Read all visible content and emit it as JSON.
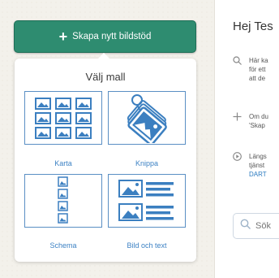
{
  "create_button": {
    "label": "Skapa nytt bildstöd",
    "icon": "plus-icon"
  },
  "templates_panel": {
    "title": "Välj mall",
    "templates": [
      {
        "label": "Karta",
        "icon": "grid-images-icon"
      },
      {
        "label": "Knippa",
        "icon": "tagged-bundle-icon"
      },
      {
        "label": "Schema",
        "icon": "vertical-schedule-icon"
      },
      {
        "label": "Bild och text",
        "icon": "image-with-text-icon"
      }
    ]
  },
  "right_pane": {
    "greeting": "Hej Tes",
    "tips": [
      {
        "icon": "search-icon",
        "lines": [
          "Här ka",
          "för ett",
          "att de"
        ]
      },
      {
        "icon": "plus-icon",
        "lines": [
          "Om du",
          "'Skap"
        ]
      },
      {
        "icon": "play-icon",
        "lines": [
          "Längs",
          "tjänst"
        ],
        "link": "DART"
      }
    ],
    "search": {
      "placeholder": "Sök"
    }
  },
  "colors": {
    "brand_green": "#2e8c70",
    "icon_blue": "#3b7fc0",
    "card_border": "#5a8fc4",
    "link_blue": "#2a7ac0"
  }
}
